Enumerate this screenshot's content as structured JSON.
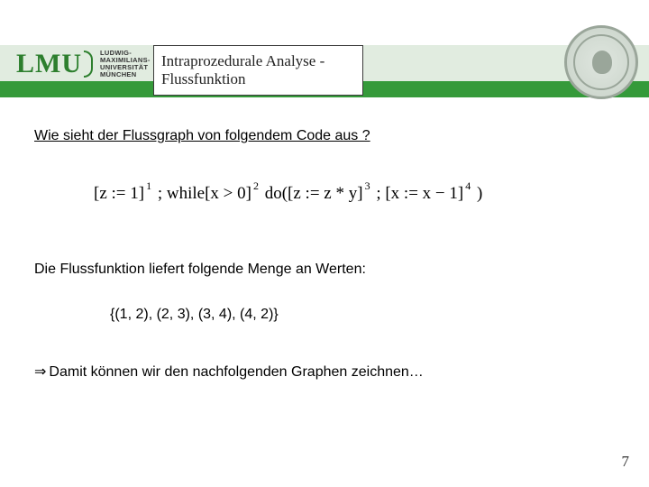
{
  "header": {
    "logo_main": "LMU",
    "logo_sub_l1": "LUDWIG-",
    "logo_sub_l2": "MAXIMILIANS-",
    "logo_sub_l3": "UNIVERSITÄT",
    "logo_sub_l4": "MÜNCHEN",
    "title": "Intraprozedurale Analyse - Flussfunktion"
  },
  "body": {
    "question": "Wie sieht der Flussgraph von folgendem Code aus ?",
    "formula": {
      "p1": "[z := 1]",
      "e1": "1",
      "p2": "; while[x > 0]",
      "e2": "2",
      "p3": " do([z := z * y]",
      "e3": "3",
      "p4": "; [x := x − 1]",
      "e4": "4",
      "p5": ")"
    },
    "statement": "Die Flussfunktion liefert folgende Menge an Werten:",
    "set": "{(1, 2), (2, 3), (3, 4), (4, 2)}",
    "arrow": "⇒",
    "conclusion": "Damit können wir den nachfolgenden Graphen zeichnen…"
  },
  "page_number": "7"
}
